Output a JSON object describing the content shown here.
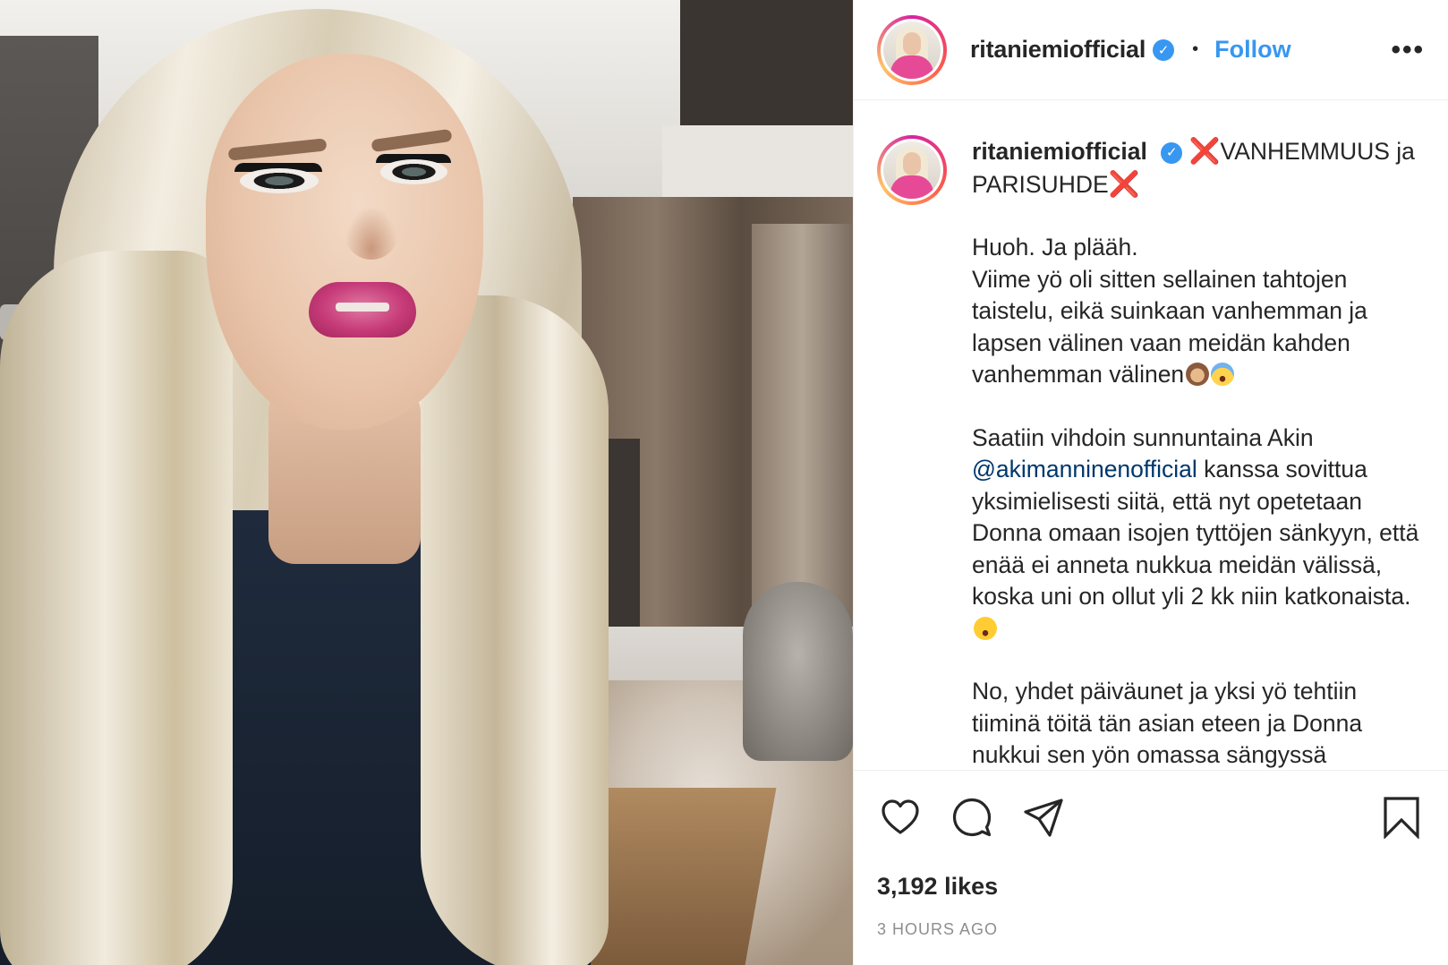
{
  "post": {
    "username": "ritaniemiofficial",
    "verified_glyph": "✓",
    "separator": "•",
    "follow_label": "Follow",
    "more_label": "•••",
    "caption": {
      "title_prefix": "❌",
      "title_main": "VANHEMMUUS ja PARISUHDE",
      "title_suffix": "❌",
      "p1_line1": "Huoh. Ja plääh.",
      "p1_line2": "Viime yö oli sitten sellainen tahtojen taistelu, eikä suinkaan vanhemman ja lapsen välinen vaan meidän kahden vanhemman välinen",
      "p2_before": "Saatiin vihdoin sunnuntaina Akin ",
      "p2_mention": "@akimanninenofficial",
      "p2_after": " kanssa sovittua yksimielisesti siitä, että nyt opetetaan Donna omaan isojen tyttöjen sänkyyn, että enää ei anneta nukkua meidän välissä, koska uni on ollut yli 2 kk niin katkonaista.",
      "p3": "No, yhdet päiväunet ja yksi yö tehtiin tiiminä töitä tän asian eteen ja Donna nukkui sen yön omassa sängyssä"
    },
    "likes": "3,192 likes",
    "timestamp": "3 HOURS AGO"
  },
  "icons": {
    "like": "heart-icon",
    "comment": "comment-icon",
    "share": "share-icon",
    "save": "bookmark-icon"
  },
  "colors": {
    "link": "#3897f0",
    "mention": "#00376b",
    "cross": "#e0202a",
    "muted": "#8e8e8e",
    "text": "#262626"
  }
}
